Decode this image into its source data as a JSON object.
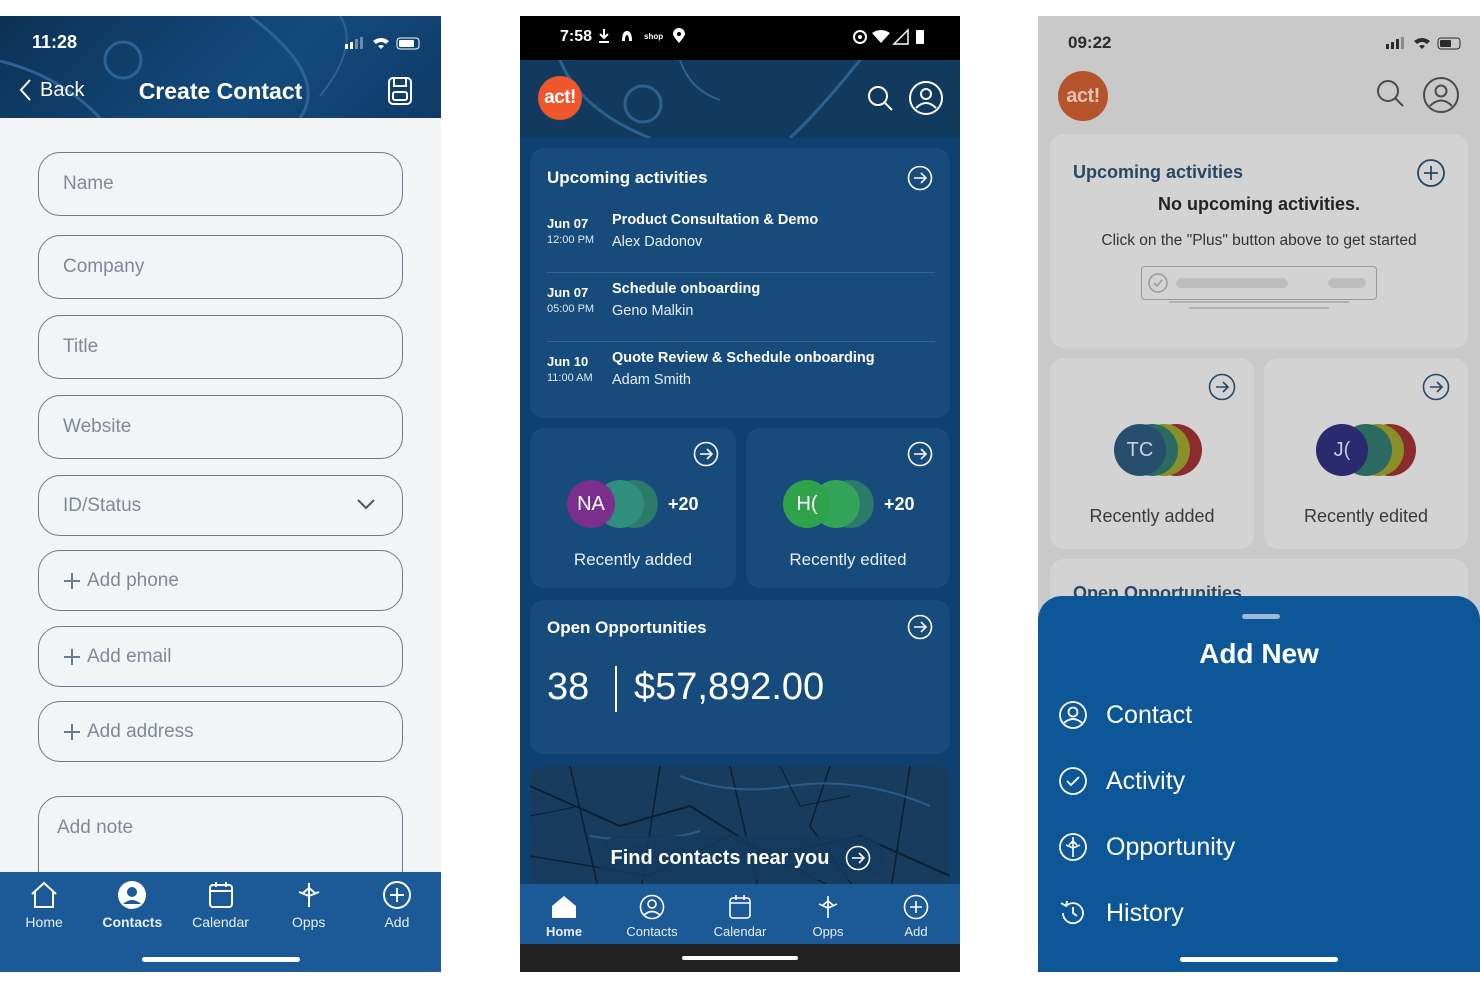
{
  "create_contact": {
    "status_time": "11:28",
    "back_label": "Back",
    "title": "Create Contact",
    "fields": {
      "name": "Name",
      "company": "Company",
      "title": "Title",
      "website": "Website",
      "id_status": "ID/Status",
      "add_phone": "Add phone",
      "add_email": "Add email",
      "add_address": "Add address",
      "add_note": "Add note"
    },
    "tabs": [
      "Home",
      "Contacts",
      "Calendar",
      "Opps",
      "Add"
    ],
    "active_tab": "Contacts"
  },
  "dashboard": {
    "status_time": "7:58",
    "status_shop": "shop",
    "logo": "act!",
    "upcoming": {
      "title": "Upcoming activities",
      "items": [
        {
          "date": "Jun 07",
          "time": "12:00 PM",
          "title": "Product Consultation & Demo",
          "person": "Alex Dadonov"
        },
        {
          "date": "Jun 07",
          "time": "05:00 PM",
          "title": "Schedule onboarding",
          "person": "Geno Malkin"
        },
        {
          "date": "Jun 10",
          "time": "11:00 AM",
          "title": "Quote Review & Schedule onboarding",
          "person": "Adam Smith"
        }
      ]
    },
    "recently_added": {
      "label": "Recently added",
      "initials": "NA",
      "more": "+20"
    },
    "recently_edited": {
      "label": "Recently edited",
      "initials": "H(",
      "more": "+20"
    },
    "opportunities": {
      "title": "Open Opportunities",
      "count": "38",
      "value": "$57,892.00"
    },
    "map_label": "Find contacts near you",
    "tabs": [
      "Home",
      "Contacts",
      "Calendar",
      "Opps",
      "Add"
    ],
    "active_tab": "Home"
  },
  "add_new": {
    "status_time": "09:22",
    "logo": "act!",
    "upcoming_title": "Upcoming activities",
    "no_upcoming": "No upcoming activities.",
    "hint": "Click on the \"Plus\" button above to get started",
    "recently_added": {
      "label": "Recently added",
      "initials": "TC"
    },
    "recently_edited": {
      "label": "Recently edited",
      "initials": "J("
    },
    "opps_peek_title": "Open Opportunities",
    "sheet": {
      "title": "Add New",
      "items": [
        "Contact",
        "Activity",
        "Opportunity",
        "History"
      ]
    }
  },
  "colors": {
    "brand_blue": "#1b5a96",
    "navy": "#0f4170",
    "act_orange": "#f0562a"
  },
  "icons": [
    "back-icon",
    "save-icon",
    "chevron-down-icon",
    "plus-icon",
    "home-icon",
    "contacts-icon",
    "calendar-icon",
    "opps-icon",
    "add-icon",
    "search-icon",
    "profile-icon",
    "arrow-right-circle-icon",
    "contact-icon",
    "activity-icon",
    "opportunity-icon",
    "history-icon"
  ]
}
